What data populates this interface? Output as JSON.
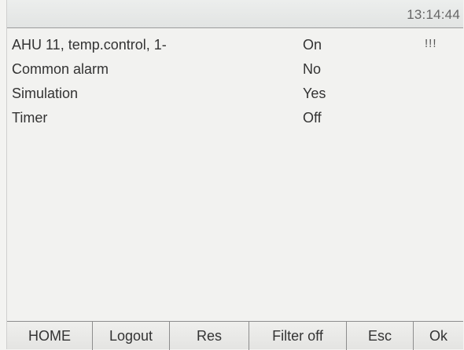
{
  "header": {
    "time": "13:14:44"
  },
  "rows": [
    {
      "name": "AHU 11, temp.control, 1-",
      "value": "On",
      "flag": "!!!"
    },
    {
      "name": "Common alarm",
      "value": "No",
      "flag": ""
    },
    {
      "name": "Simulation",
      "value": "Yes",
      "flag": ""
    },
    {
      "name": "Timer",
      "value": "Off",
      "flag": ""
    }
  ],
  "softkeys": [
    {
      "label": "HOME"
    },
    {
      "label": "Logout"
    },
    {
      "label": "Res"
    },
    {
      "label": "Filter off"
    },
    {
      "label": "Esc"
    },
    {
      "label": "Ok"
    }
  ]
}
